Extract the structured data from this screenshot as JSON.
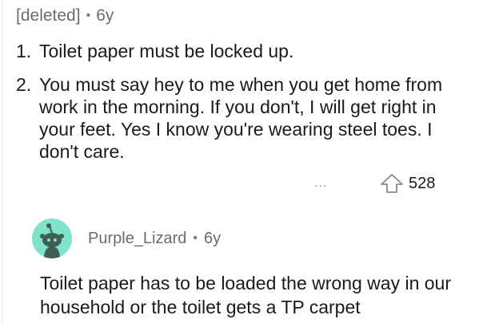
{
  "comment": {
    "author": "[deleted]",
    "age": "6y",
    "rules": [
      {
        "number": "1.",
        "text": "Toilet paper must be locked up."
      },
      {
        "number": "2.",
        "text": "You must say hey to me when you get home from work in the morning. If you don't, I will get right in your feet. Yes I know you're wearing steel toes. I don't care."
      }
    ],
    "more_label": "...",
    "votes": "528"
  },
  "reply": {
    "author": "Purple_Lizard",
    "age": "6y",
    "body": "Toilet paper has to be loaded the wrong way in our household or the toilet gets a TP carpet"
  },
  "icons": {
    "upvote": "upvote-arrow-icon",
    "avatar": "snoo-avatar-icon"
  },
  "colors": {
    "avatar_bg": "#7fe3cc",
    "meta_text": "#6b6b6b",
    "body_text": "#1a1a1b"
  }
}
